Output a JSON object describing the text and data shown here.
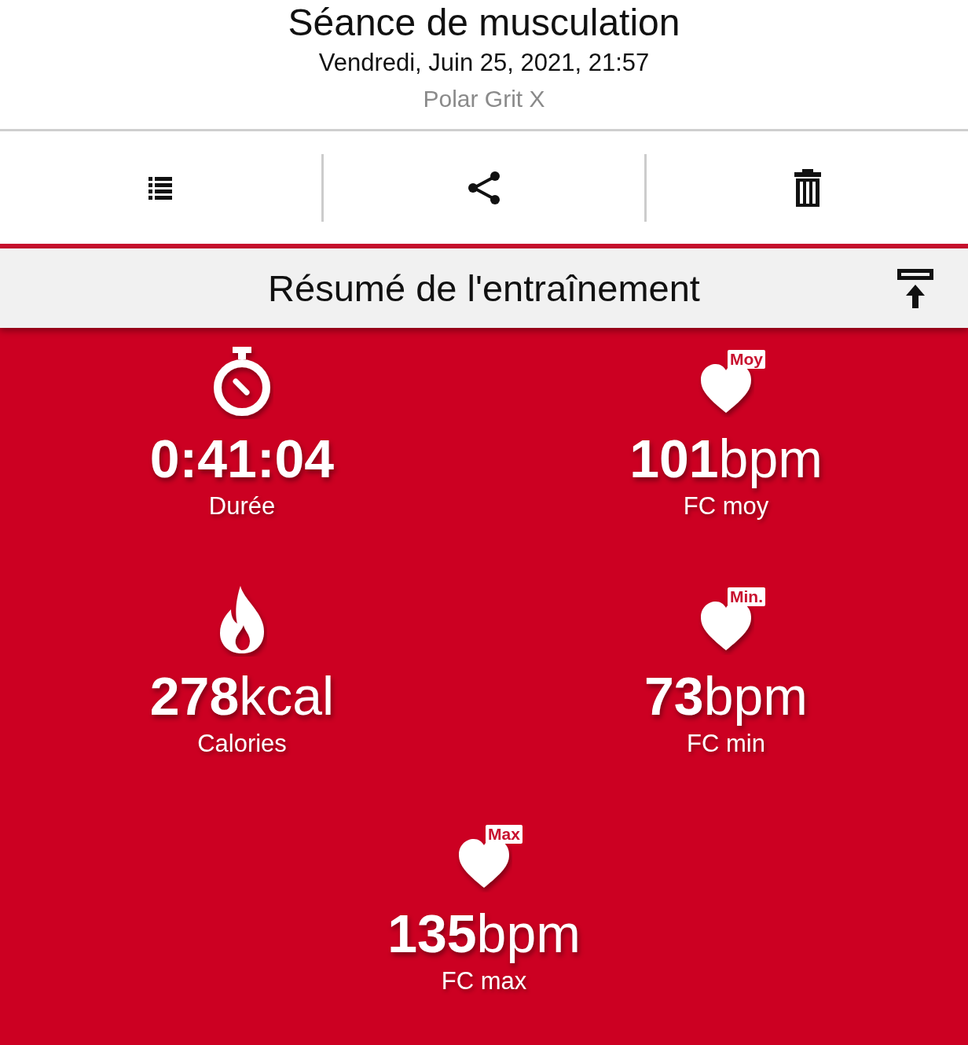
{
  "header": {
    "title": "Séance de musculation",
    "date": "Vendredi, Juin 25, 2021, 21:57",
    "device": "Polar Grit X"
  },
  "toolbar": [
    {
      "kind": "list"
    },
    {
      "kind": "share"
    },
    {
      "kind": "delete"
    }
  ],
  "summary": {
    "title": "Résumé de l'entraînement"
  },
  "stats": [
    {
      "kind": "stopwatch",
      "value": "0:41:04",
      "label": "Durée"
    },
    {
      "kind": "heart",
      "badge": "Moy",
      "value": "101",
      "unit": "bpm",
      "label": "FC moy"
    },
    {
      "kind": "flame",
      "value": "278",
      "unit": "kcal",
      "label": "Calories"
    },
    {
      "kind": "heart",
      "badge": "Min.",
      "value": "73",
      "unit": "bpm",
      "label": "FC min"
    },
    {
      "kind": "heart",
      "badge": "Max",
      "value": "135",
      "unit": "bpm",
      "label": "FC max"
    }
  ]
}
